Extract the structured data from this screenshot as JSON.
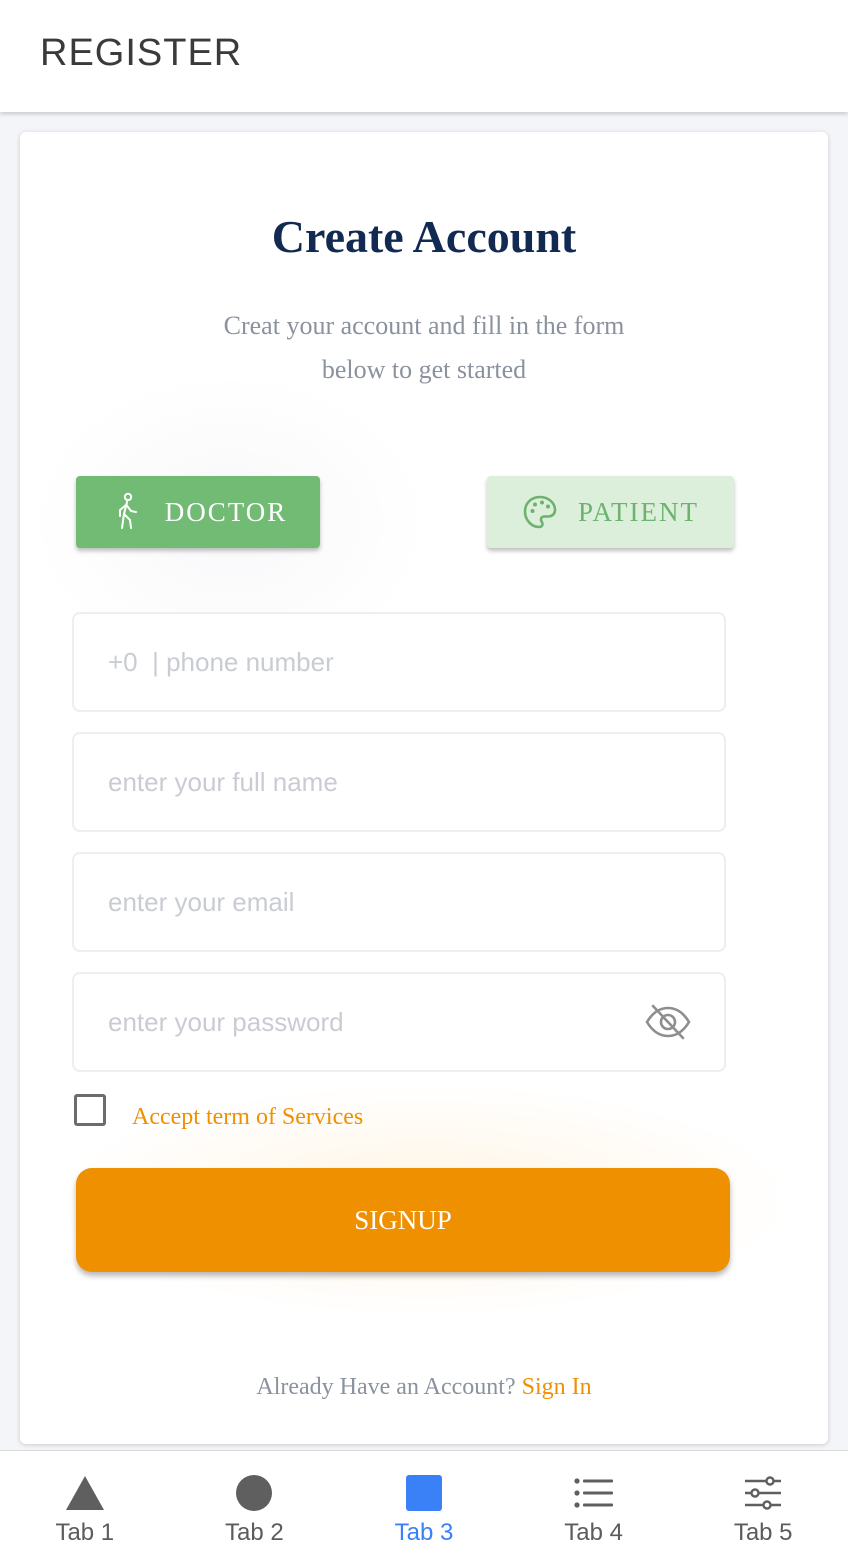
{
  "header": {
    "title": "REGISTER"
  },
  "card": {
    "title": "Create Account",
    "subtitle_line1": "Creat your account and fill in the form",
    "subtitle_line2": "below to get started"
  },
  "roles": {
    "doctor": {
      "label": "DOCTOR",
      "icon": "walking-person-icon",
      "selected": true
    },
    "patient": {
      "label": "PATIENT",
      "icon": "palette-icon",
      "selected": false
    }
  },
  "form": {
    "phone": {
      "placeholder": "+0  | phone number",
      "value": ""
    },
    "full_name": {
      "placeholder": "enter your full name",
      "value": ""
    },
    "email": {
      "placeholder": "enter your email",
      "value": ""
    },
    "password": {
      "placeholder": "enter your password",
      "value": "",
      "toggle_icon": "eye-off-icon"
    },
    "terms": {
      "label": "Accept term of Services",
      "checked": false
    },
    "signup_label": "SIGNUP"
  },
  "footer": {
    "prompt": "Already Have an Account?",
    "link": "Sign In"
  },
  "colors": {
    "accent": "#ef9000",
    "doctor_bg": "#72bb75",
    "patient_bg": "#dcefdb",
    "title": "#122a52",
    "tab_active": "#3a80f6"
  },
  "tabs": [
    {
      "label": "Tab 1",
      "icon": "triangle-icon",
      "active": false
    },
    {
      "label": "Tab 2",
      "icon": "circle-icon",
      "active": false
    },
    {
      "label": "Tab 3",
      "icon": "square-icon",
      "active": true
    },
    {
      "label": "Tab 4",
      "icon": "list-icon",
      "active": false
    },
    {
      "label": "Tab 5",
      "icon": "sliders-icon",
      "active": false
    }
  ]
}
